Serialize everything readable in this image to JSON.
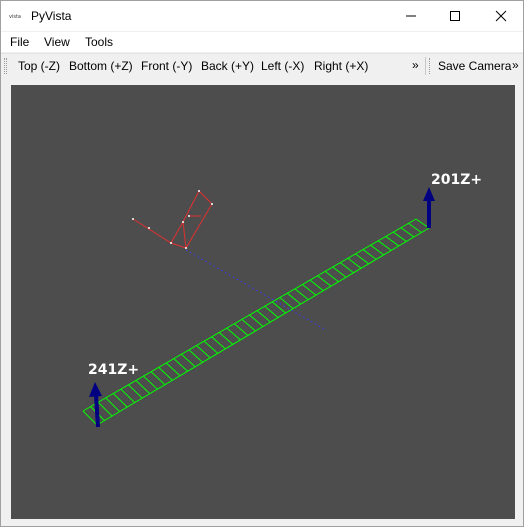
{
  "window": {
    "title": "PyVista",
    "app_icon": "pyvista-logo-icon",
    "controls": [
      "minimize-icon",
      "maximize-icon",
      "close-icon"
    ]
  },
  "menu": {
    "file": "File",
    "view": "View",
    "tools": "Tools"
  },
  "toolbar": {
    "top": "Top (-Z)",
    "bottom": "Bottom (+Z)",
    "front": "Front (-Y)",
    "back": "Back (+Y)",
    "left": "Left (-X)",
    "right": "Right (+X)",
    "overflow": "»",
    "save_camera": "Save Camera",
    "overflow2": "»"
  },
  "scene": {
    "background_color": "#4d4d4d",
    "labels": {
      "node_201": "201Z+",
      "node_241": "241Z+"
    },
    "colors": {
      "beam_mesh": "#00ff00",
      "arrows": "#000080",
      "frame_red": "#e03030",
      "axis_blue": "#3a3aff"
    }
  }
}
